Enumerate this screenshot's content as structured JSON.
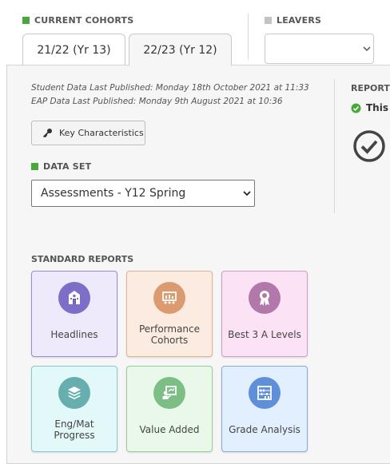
{
  "cohorts": {
    "label": "CURRENT COHORTS",
    "tabs": [
      {
        "label": "21/22 (Yr 13)",
        "active": false
      },
      {
        "label": "22/23 (Yr 12)",
        "active": true
      }
    ]
  },
  "leavers": {
    "label": "LEAVERS",
    "selected": ""
  },
  "publish_info": {
    "student": "Student Data Last Published: Monday 18th October 2021 at 11:33",
    "eap": "EAP Data Last Published: Monday 9th August 2021 at 10:36"
  },
  "key_characteristics": {
    "label": "Key Characteristics",
    "icon": "key-icon"
  },
  "dataset": {
    "label": "DATA SET",
    "selected": "Assessments - Y12 Spring"
  },
  "report_status": {
    "label": "REPORT",
    "text": "This",
    "icon": "check-circle-icon"
  },
  "standard_reports": {
    "label": "STANDARD REPORTS",
    "cards": [
      {
        "label": "Headlines",
        "icon": "school-icon",
        "bg": "#efeafb",
        "border": "#9a8dcb",
        "circle": "#7d6ec8"
      },
      {
        "label": "Performance Cohorts",
        "icon": "presentation-icon",
        "bg": "#fcebe0",
        "border": "#e2b392",
        "circle": "#dc9a71"
      },
      {
        "label": "Best 3 A Levels",
        "icon": "award-icon",
        "bg": "#fbe3f5",
        "border": "#cf9dc6",
        "circle": "#b278ab"
      },
      {
        "label": "Eng/Mat Progress",
        "icon": "layers-icon",
        "bg": "#e3f8f8",
        "border": "#8cc9c8",
        "circle": "#67afae"
      },
      {
        "label": "Value Added",
        "icon": "teacher-board-icon",
        "bg": "#e9f8e9",
        "border": "#97cf97",
        "circle": "#7cbe85"
      },
      {
        "label": "Grade Analysis",
        "icon": "abacus-icon",
        "bg": "#e1efff",
        "border": "#86abdc",
        "circle": "#5f8fd8"
      }
    ]
  },
  "colors": {
    "cohort_marker": "#4aa83a",
    "leavers_marker": "#c4c4c4",
    "check_green": "#4aa83a"
  }
}
